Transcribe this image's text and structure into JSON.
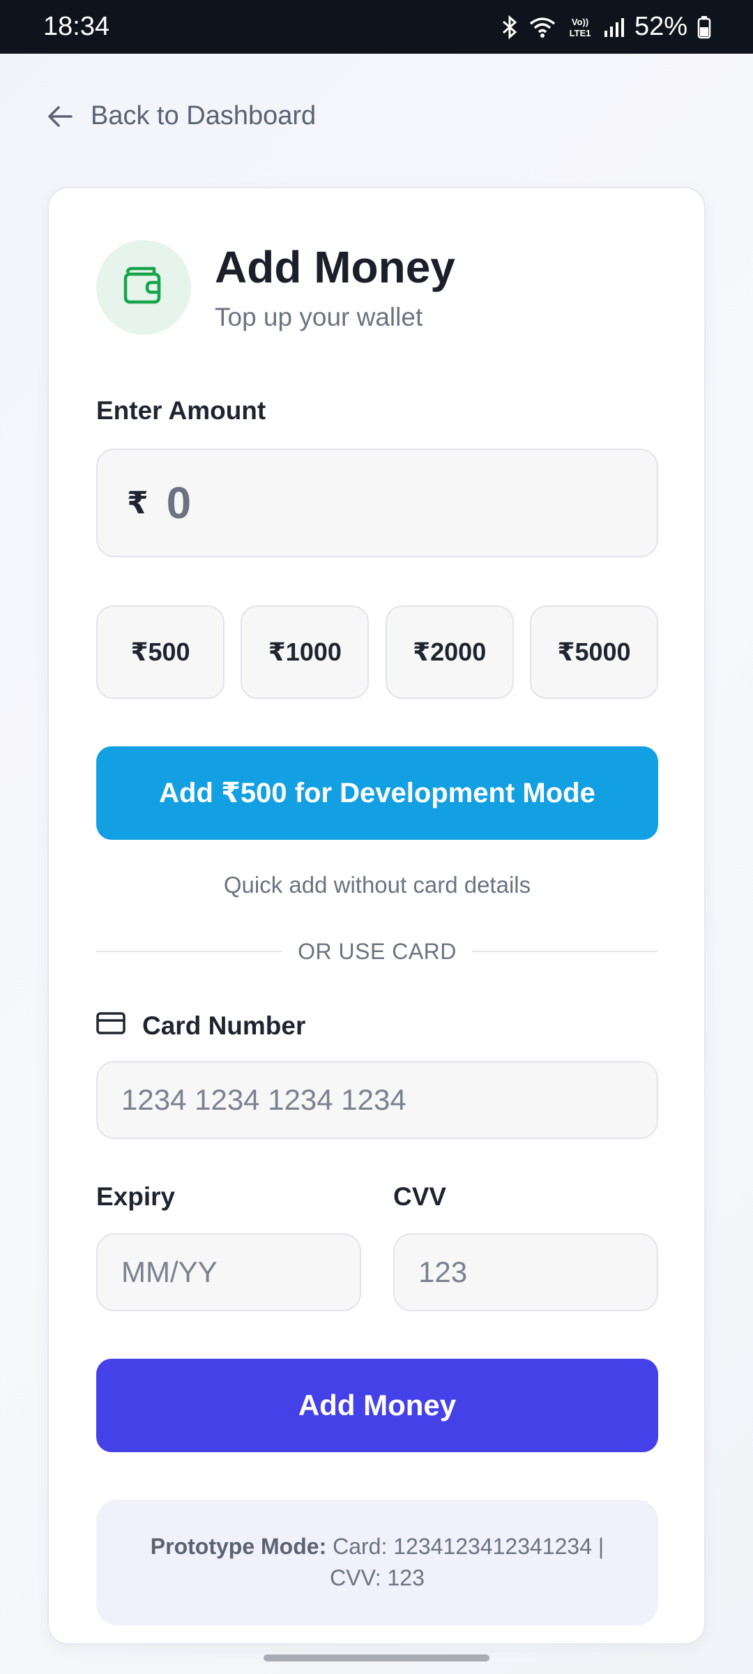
{
  "status_bar": {
    "time": "18:34",
    "battery": "52%",
    "lte_label": "Vo)) LTE1",
    "icons": [
      "bluetooth-icon",
      "wifi-icon",
      "lte-icon",
      "signal-icon",
      "battery-icon"
    ]
  },
  "nav": {
    "back_label": "Back to Dashboard"
  },
  "header": {
    "title": "Add Money",
    "subtitle": "Top up your wallet",
    "icon": "wallet-icon"
  },
  "amount": {
    "label": "Enter Amount",
    "currency": "₹",
    "value": "0",
    "presets": [
      "₹500",
      "₹1000",
      "₹2000",
      "₹5000"
    ]
  },
  "dev_mode": {
    "button_label": "Add ₹500 for Development Mode",
    "hint": "Quick add without card details"
  },
  "divider": {
    "text": "OR USE CARD"
  },
  "card_form": {
    "card_number_label": "Card Number",
    "card_number_placeholder": "1234 1234 1234 1234",
    "expiry_label": "Expiry",
    "expiry_placeholder": "MM/YY",
    "cvv_label": "CVV",
    "cvv_placeholder": "123",
    "submit_label": "Add Money"
  },
  "prototype_note": {
    "prefix": "Prototype Mode:",
    "text": " Card: 1234123412341234 | CVV: 123"
  },
  "colors": {
    "status_bar_bg": "#0f141c",
    "dev_button": "#12a0e3",
    "primary_button": "#4541e8",
    "wallet_icon": "#16a34a",
    "wallet_badge_bg": "#e6f4ec"
  }
}
